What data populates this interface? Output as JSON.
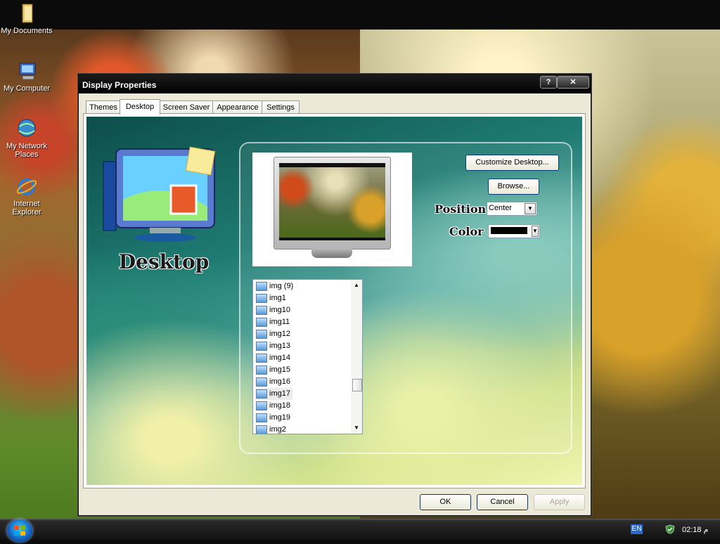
{
  "desktop": {
    "icons": [
      {
        "label": "My Documents",
        "icon": "folder-icon"
      },
      {
        "label": "My Computer",
        "icon": "computer-icon"
      },
      {
        "label": "My Network Places",
        "icon": "network-icon"
      },
      {
        "label": "Internet Explorer",
        "icon": "ie-icon"
      }
    ]
  },
  "dialog": {
    "title": "Display Properties",
    "help_label": "?",
    "close_label": "✕",
    "tabs": [
      {
        "label": "Themes"
      },
      {
        "label": "Desktop"
      },
      {
        "label": "Screen Saver"
      },
      {
        "label": "Appearance"
      },
      {
        "label": "Settings"
      }
    ],
    "active_tab": "Desktop",
    "panel": {
      "caption": "Desktop",
      "customize_button": "Customize Desktop...",
      "browse_button": "Browse...",
      "position_label": "Position :",
      "position_value": "Center",
      "color_label": "Color :",
      "color_value": "#000000",
      "background_list": [
        "img (9)",
        "img1",
        "img10",
        "img11",
        "img12",
        "img13",
        "img14",
        "img15",
        "img16",
        "img17",
        "img18",
        "img19",
        "img2"
      ],
      "selected_background": "img17"
    },
    "ok_button": "OK",
    "cancel_button": "Cancel",
    "apply_button": "Apply"
  },
  "taskbar": {
    "language": "EN",
    "clock": "02:18 م"
  }
}
